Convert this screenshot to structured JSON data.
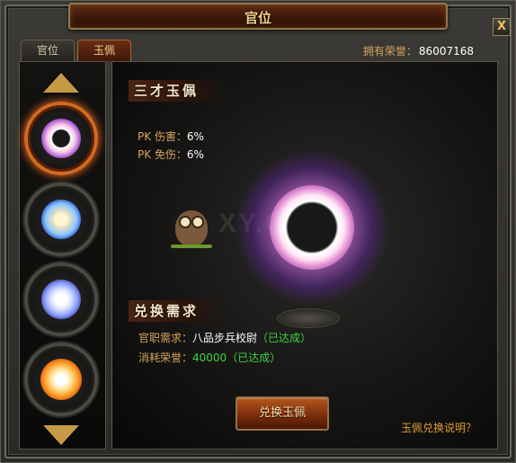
{
  "window": {
    "title": "官位",
    "close_label": "X"
  },
  "tabs": [
    {
      "label": "官位",
      "active": false
    },
    {
      "label": "玉佩",
      "active": true
    }
  ],
  "honor": {
    "label": "拥有荣誉：",
    "value": "86007168"
  },
  "jade_list": [
    {
      "icon": "purple-jade-icon",
      "selected": true
    },
    {
      "icon": "blue-jade-icon",
      "selected": false
    },
    {
      "icon": "white-blue-jade-icon",
      "selected": false
    },
    {
      "icon": "golden-jade-icon",
      "selected": false
    }
  ],
  "jade_detail": {
    "name": "三才玉佩",
    "stats": [
      {
        "label": "PK 伤害：",
        "value": "6%"
      },
      {
        "label": "PK 免伤：",
        "value": "6%"
      }
    ]
  },
  "requirements": {
    "title": "兑换需求",
    "items": [
      {
        "label": "官职需求：",
        "value": "八品步兵校尉",
        "status": "（已达成）"
      },
      {
        "label": "消耗荣誉：",
        "value": "40000",
        "status": "（已达成）"
      }
    ]
  },
  "watermark": "XY.COM",
  "buttons": {
    "exchange": "兑换玉佩",
    "help": "玉佩兑换说明？"
  },
  "colors": {
    "accent": "#d7a45a",
    "success": "#3fd23f",
    "title": "#f3d48a"
  }
}
